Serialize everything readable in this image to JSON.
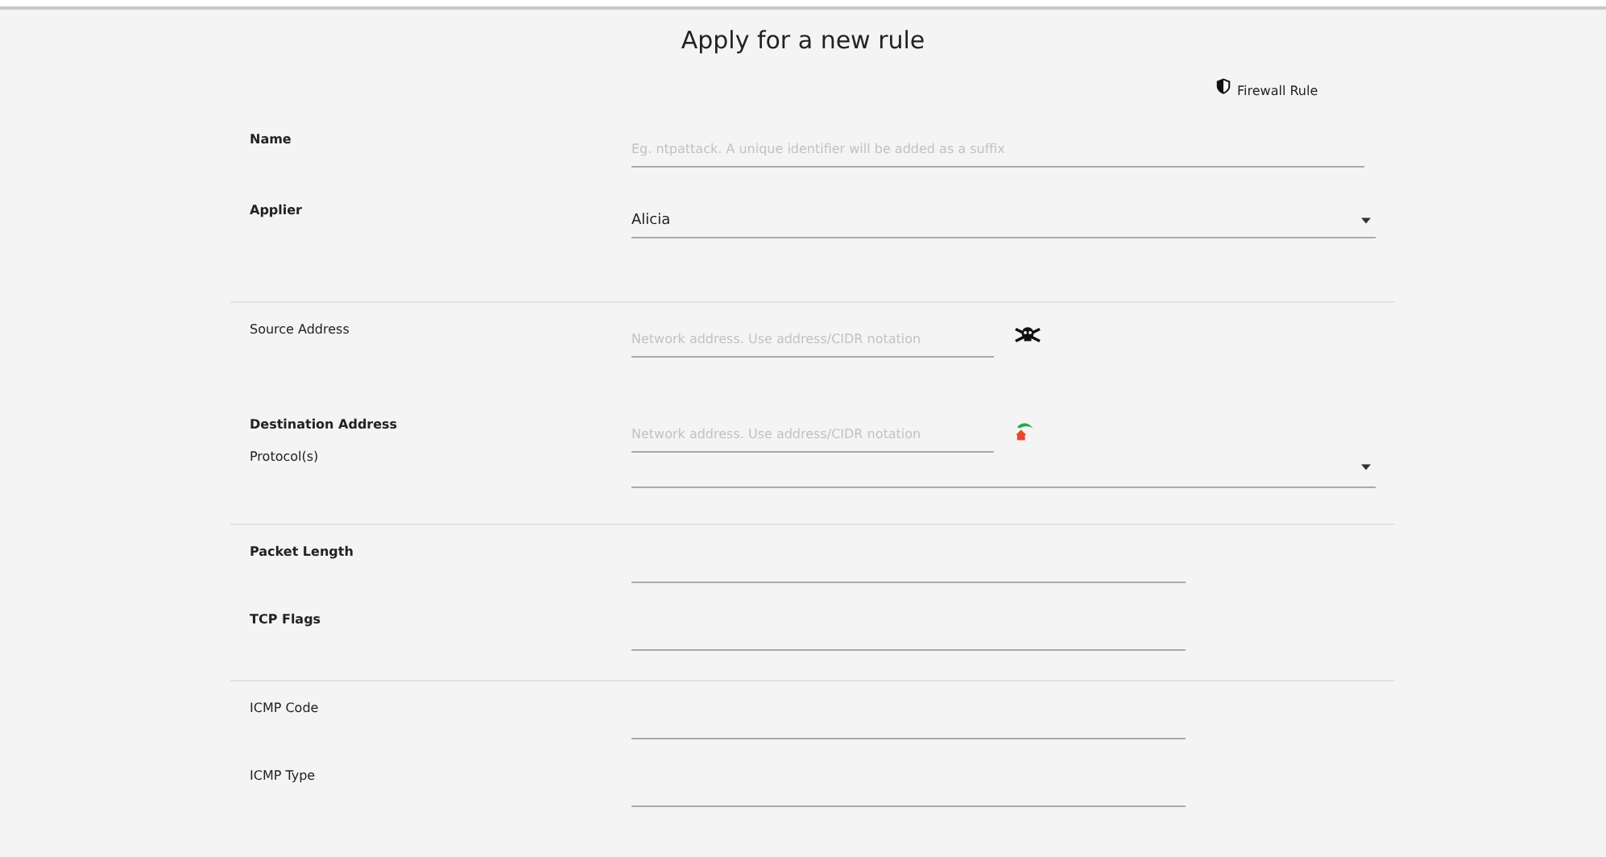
{
  "title": "Apply for a new rule",
  "rule_type": {
    "label": "Firewall Rule"
  },
  "sections": [
    {
      "fields": [
        {
          "label": "Name",
          "bold": true,
          "kind": "input",
          "placeholder": "Eg. ntpattack. A unique identifier will be added as a suffix"
        },
        {
          "label": "Applier",
          "bold": true,
          "kind": "select",
          "value": "Alicia"
        }
      ]
    },
    {
      "fields": [
        {
          "label": "Source Address",
          "bold": false,
          "kind": "address",
          "placeholder": "Network address. Use address/CIDR notation"
        },
        {
          "label": "Destination Address",
          "bold": true,
          "kind": "address",
          "placeholder": "Network address. Use address/CIDR notation"
        },
        {
          "label": "Protocol(s)",
          "bold": false,
          "kind": "select"
        }
      ]
    },
    {
      "fields": [
        {
          "label": "Packet Length",
          "bold": true,
          "kind": "plain"
        },
        {
          "label": "TCP Flags",
          "bold": true,
          "kind": "plain"
        }
      ]
    },
    {
      "fields": [
        {
          "label": "ICMP Code",
          "bold": false,
          "kind": "plain"
        },
        {
          "label": "ICMP Type",
          "bold": false,
          "kind": "plain"
        }
      ]
    }
  ]
}
